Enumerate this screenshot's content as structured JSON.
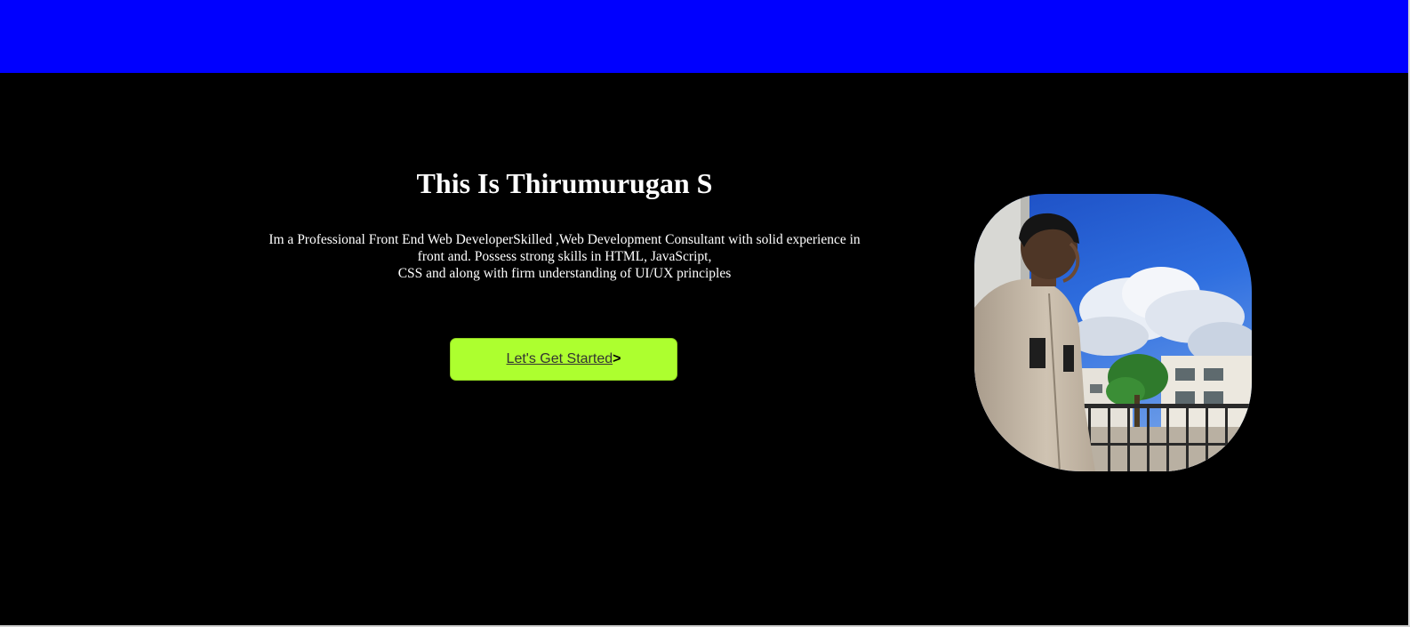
{
  "header": {
    "bar_color": "#0000ff"
  },
  "hero": {
    "title": "This Is Thirumurugan S",
    "description_lines": [
      "Im a Professional Front End Web DeveloperSkilled ,Web Development Consultant with solid experience in",
      "front and. Possess strong skills in HTML, JavaScript,",
      "CSS and along with firm understanding of UI/UX principles"
    ],
    "cta": {
      "label": "Let's Get Started",
      "arrow": ">",
      "color": "#adff2f"
    }
  },
  "theme": {
    "background": "#000000",
    "text": "#ffffff"
  }
}
